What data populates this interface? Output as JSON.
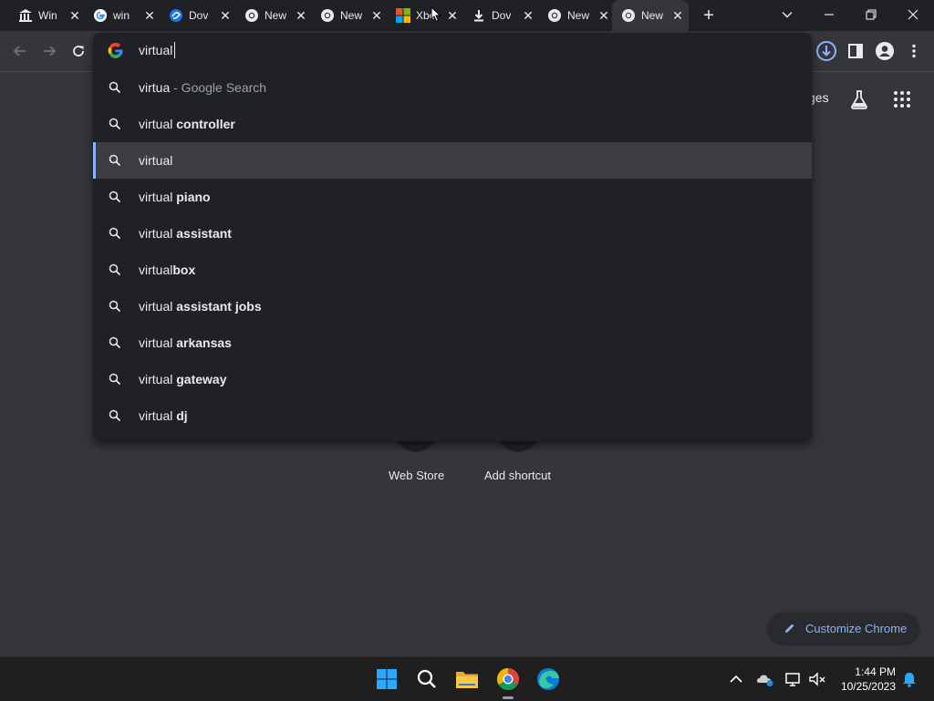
{
  "tabs": [
    {
      "title": "Win",
      "icon": "bank-icon"
    },
    {
      "title": "win",
      "icon": "google-g-icon"
    },
    {
      "title": "Dov",
      "icon": "blue-swirl-icon"
    },
    {
      "title": "New",
      "icon": "chrome-icon"
    },
    {
      "title": "New",
      "icon": "chrome-icon"
    },
    {
      "title": "Xbo",
      "icon": "microsoft-logo-icon"
    },
    {
      "title": "Dov",
      "icon": "download-icon"
    },
    {
      "title": "New",
      "icon": "chrome-icon"
    },
    {
      "title": "New",
      "icon": "chrome-icon"
    }
  ],
  "omnibox": {
    "value": "virtual",
    "suggestions": [
      {
        "prefix": "virtua",
        "bold": "",
        "suffix": " - Google Search"
      },
      {
        "prefix": "virtual",
        "bold": " controller",
        "suffix": ""
      },
      {
        "prefix": "virtual",
        "bold": "",
        "suffix": "",
        "selected": true
      },
      {
        "prefix": "virtual",
        "bold": " piano",
        "suffix": ""
      },
      {
        "prefix": "virtual",
        "bold": " assistant",
        "suffix": ""
      },
      {
        "prefix": "virtual",
        "bold": "box",
        "suffix": ""
      },
      {
        "prefix": "virtual",
        "bold": " assistant jobs",
        "suffix": ""
      },
      {
        "prefix": "virtual",
        "bold": " arkansas",
        "suffix": ""
      },
      {
        "prefix": "virtual",
        "bold": " gateway",
        "suffix": ""
      },
      {
        "prefix": "virtual",
        "bold": " dj",
        "suffix": ""
      }
    ]
  },
  "page": {
    "images_link": "ges",
    "shortcuts": [
      {
        "label": "Web Store"
      },
      {
        "label": "Add shortcut"
      }
    ],
    "customize_label": "Customize Chrome"
  },
  "taskbar": {
    "time": "1:44 PM",
    "date": "10/25/2023"
  },
  "colors": {
    "accent": "#8ab4f8",
    "frame": "#202124",
    "toolbar": "#35363a"
  }
}
